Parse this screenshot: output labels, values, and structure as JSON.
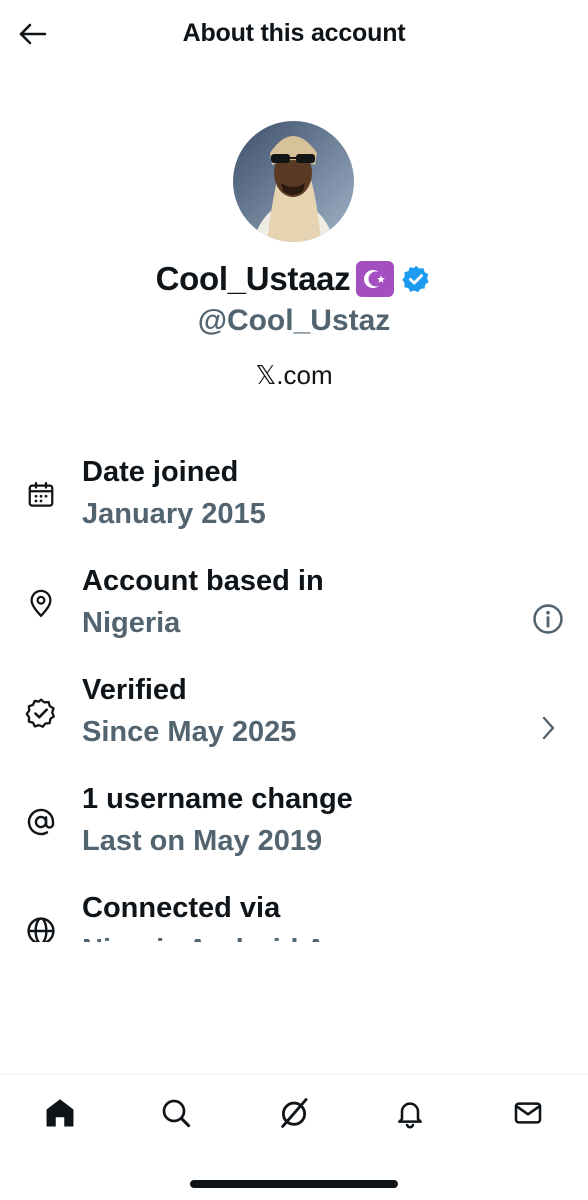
{
  "header": {
    "title": "About this account"
  },
  "profile": {
    "display_name": "Cool_Ustaaz",
    "handle": "@Cool_Ustaz",
    "source": "𝕏.com",
    "colors": {
      "verified": "#1d9bf0",
      "emoji_bg": "#a44fc0"
    }
  },
  "info": {
    "date_joined": {
      "title": "Date joined",
      "value": "January 2015",
      "icon": "calendar-icon"
    },
    "based_in": {
      "title": "Account based in",
      "value": "Nigeria",
      "icon": "location-pin-icon"
    },
    "verified": {
      "title": "Verified",
      "value": "Since May 2025",
      "icon": "verified-icon"
    },
    "username": {
      "title": "1 username change",
      "value": "Last on May 2019",
      "icon": "at-sign-icon"
    },
    "connected": {
      "title": "Connected via",
      "value": "Nigeria Android App",
      "icon": "globe-icon"
    }
  },
  "tabs": [
    "home-icon",
    "search-icon",
    "grok-icon",
    "bell-icon",
    "mail-icon"
  ],
  "colors": {
    "text_primary": "#0f1419",
    "text_secondary": "#536471"
  }
}
